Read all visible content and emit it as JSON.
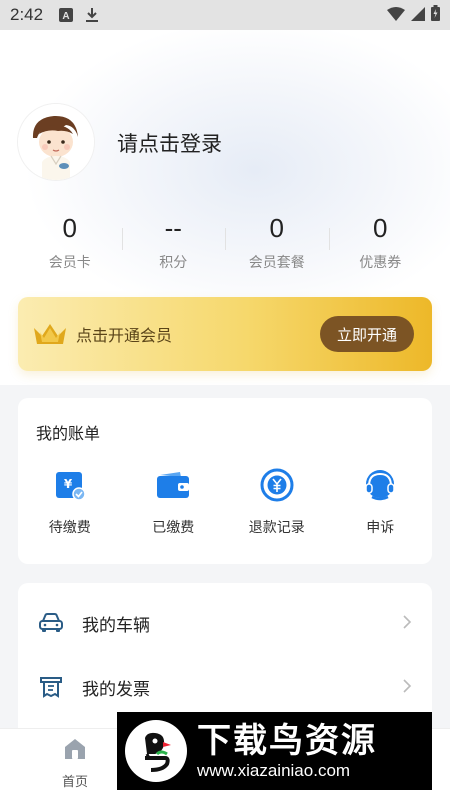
{
  "status_bar": {
    "time": "2:42",
    "icons": [
      "font-icon",
      "download-icon",
      "wifi-icon",
      "signal-icon",
      "battery-icon"
    ]
  },
  "profile": {
    "login_prompt": "请点击登录"
  },
  "stats": [
    {
      "value": "0",
      "label": "会员卡"
    },
    {
      "value": "--",
      "label": "积分"
    },
    {
      "value": "0",
      "label": "会员套餐"
    },
    {
      "value": "0",
      "label": "优惠券"
    }
  ],
  "vip_banner": {
    "text": "点击开通会员",
    "button": "立即开通",
    "colors": {
      "start": "#fbecb1",
      "end": "#edb829",
      "button": "#7c5424"
    }
  },
  "bill": {
    "title": "我的账单",
    "items": [
      {
        "label": "待缴费",
        "icon": "pending-bill-icon"
      },
      {
        "label": "已缴费",
        "icon": "wallet-icon"
      },
      {
        "label": "退款记录",
        "icon": "yuan-circle-icon"
      },
      {
        "label": "申诉",
        "icon": "headset-icon"
      }
    ]
  },
  "menu": [
    {
      "label": "我的车辆",
      "icon": "car-icon"
    },
    {
      "label": "我的发票",
      "icon": "invoice-icon"
    }
  ],
  "bottom_nav": {
    "home": "首页"
  },
  "watermark": {
    "title": "下载鸟资源",
    "url": "www.xiazainiao.com"
  },
  "accent_color": "#1e7ee8"
}
